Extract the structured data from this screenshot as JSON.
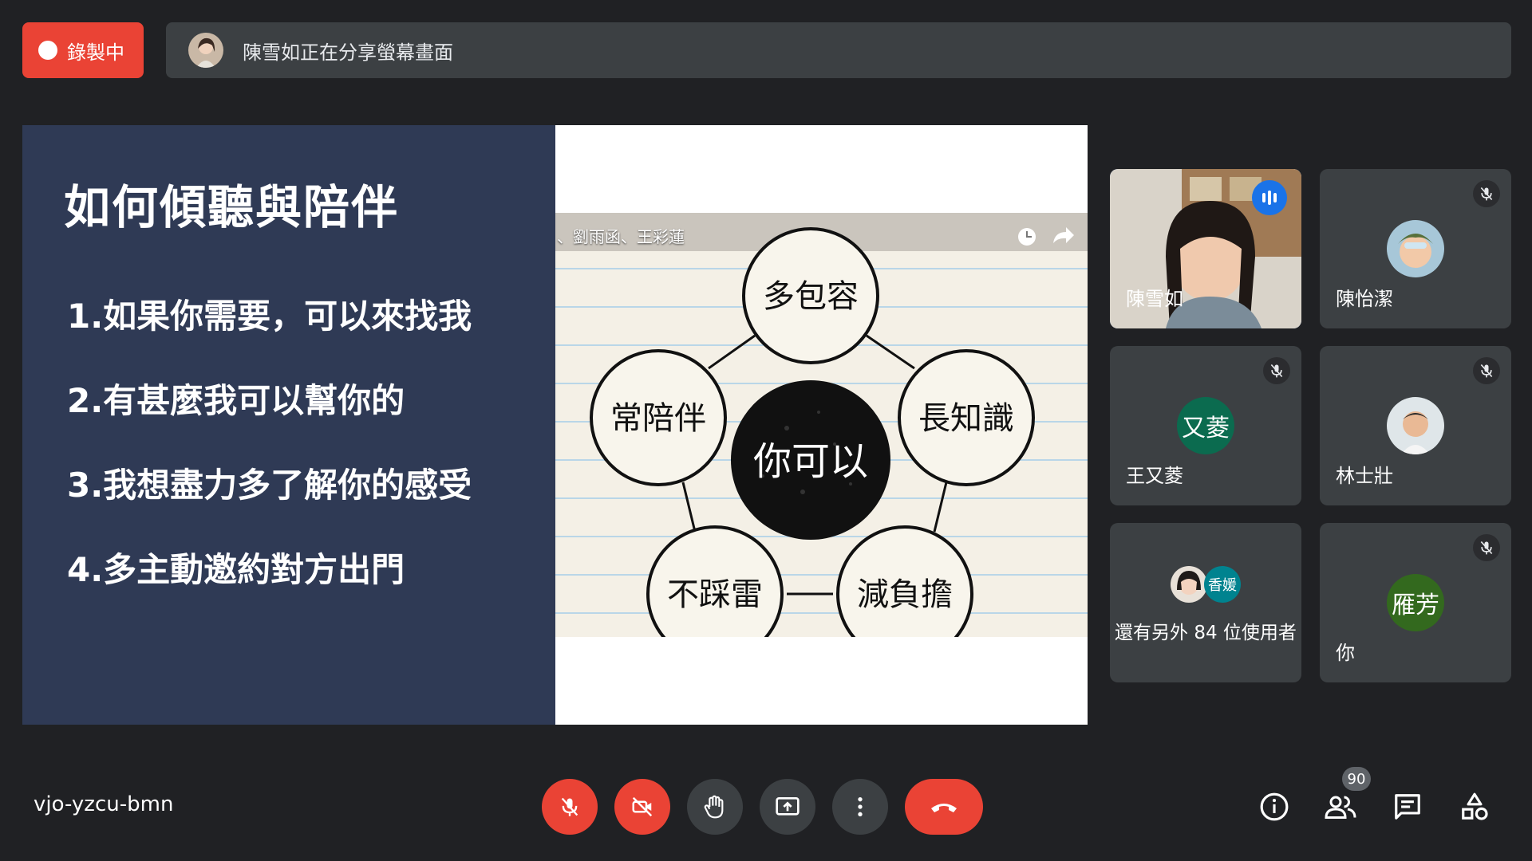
{
  "recording": {
    "label": "錄製中"
  },
  "share_banner": {
    "text": "陳雪如正在分享螢幕畫面"
  },
  "slide": {
    "title": "如何傾聽與陪伴",
    "items": [
      "1.如果你需要，可以來找我",
      "2.有甚麼我可以幫你的",
      "3.我想盡力多了解你的感受",
      "4.多主動邀約對方出門"
    ]
  },
  "video": {
    "caption": "、劉雨函、王彩蓮",
    "diagram": {
      "center": "你可以",
      "nodes": [
        "多包容",
        "長知識",
        "減負擔",
        "不踩雷",
        "常陪伴"
      ]
    }
  },
  "participants": [
    {
      "name": "陳雪如",
      "speaking": true
    },
    {
      "name": "陳怡潔",
      "muted": true
    },
    {
      "name": "王又菱",
      "initials": "又菱",
      "muted": true,
      "color": "#0b6b4f"
    },
    {
      "name": "林士壯",
      "muted": true
    },
    {
      "name": "還有另外 84 位使用者",
      "badge": "香媛"
    },
    {
      "name": "你",
      "initials": "雁芳",
      "muted": true,
      "color": "#33691e"
    }
  ],
  "meeting_code": "vjo-yzcu-bmn",
  "people_count": "90",
  "colors": {
    "recording": "#ea4335",
    "tile": "#3c4043",
    "active_border": "#8ab4f8",
    "slide_bg": "#2f3a55"
  }
}
